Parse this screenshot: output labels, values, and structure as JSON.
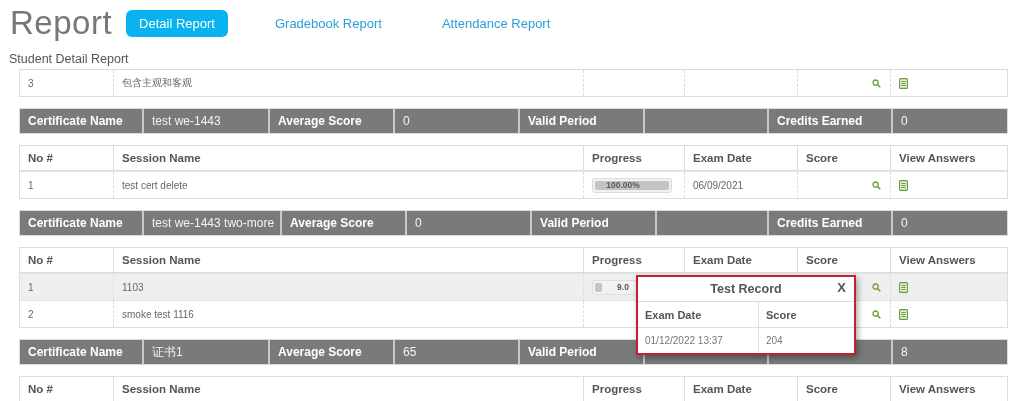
{
  "page_title": "Report",
  "tabs": [
    {
      "label": "Detail Report",
      "selected": true
    },
    {
      "label": "Gradebook Report",
      "selected": false
    },
    {
      "label": "Attendance Report",
      "selected": false
    }
  ],
  "section_title": "Student Detail Report",
  "blocks": [
    {
      "kind": "sessions",
      "rows": [
        {
          "no": "3",
          "session": "包含主观和客观",
          "selected": false
        }
      ]
    },
    {
      "kind": "certificate",
      "cells": [
        {
          "kind": "label",
          "text": "Certificate Name"
        },
        {
          "kind": "value",
          "text": "test we-1443"
        },
        {
          "kind": "label",
          "text": "Average Score"
        },
        {
          "kind": "value",
          "text": "0"
        },
        {
          "kind": "label",
          "text": "Valid Period"
        },
        {
          "kind": "value"
        },
        {
          "kind": "label",
          "text": "Credits Earned"
        },
        {
          "kind": "value",
          "text": "0"
        }
      ]
    },
    {
      "kind": "sessions",
      "columns": [
        "No #",
        "Session Name",
        "Progress",
        "Exam Date",
        "Score",
        "View Answers"
      ],
      "rows": [
        {
          "no": "1",
          "session": "test cert delete",
          "progress": {
            "level": 1,
            "label": "100.00%"
          },
          "exam_date": "06/09/2021",
          "selected": false
        }
      ]
    },
    {
      "kind": "certificate",
      "cells": [
        {
          "kind": "label",
          "text": "Certificate Name"
        },
        {
          "kind": "value",
          "text": "test we-1443 two-more"
        },
        {
          "kind": "label",
          "text": "Average Score"
        },
        {
          "kind": "value",
          "text": "0"
        },
        {
          "kind": "label",
          "text": "Valid Period"
        },
        {
          "kind": "value"
        },
        {
          "kind": "label",
          "text": "Credits Earned"
        },
        {
          "kind": "value",
          "text": "0"
        }
      ]
    },
    {
      "kind": "sessions",
      "columns": [
        "No #",
        "Session Name",
        "Progress",
        "Exam Date",
        "Score",
        "View Answers"
      ],
      "rows": [
        {
          "no": "1",
          "session": "1103",
          "progress": {
            "level": 0.09,
            "label": "9.0"
          },
          "selected": true
        },
        {
          "no": "2",
          "session": "smoke test 1116",
          "selected": false
        }
      ]
    },
    {
      "kind": "certificate",
      "cells": [
        {
          "kind": "label",
          "text": "Certificate Name"
        },
        {
          "kind": "value",
          "text": "证书1"
        },
        {
          "kind": "label",
          "text": "Average Score"
        },
        {
          "kind": "value",
          "text": "65"
        },
        {
          "kind": "label",
          "text": "Valid Period"
        },
        {
          "kind": "value"
        },
        {
          "kind": "label"
        },
        {
          "kind": "value",
          "text": "8"
        }
      ]
    },
    {
      "kind": "sessions",
      "columns": [
        "No #",
        "Session Name",
        "Progress",
        "Exam Date",
        "Score",
        "View Answers"
      ]
    }
  ],
  "popup": {
    "title": "Test Record",
    "close": "X",
    "columns": [
      "Exam Date",
      "Score"
    ],
    "rows": [
      [
        "01/12/2022 13:37",
        "204"
      ]
    ]
  }
}
